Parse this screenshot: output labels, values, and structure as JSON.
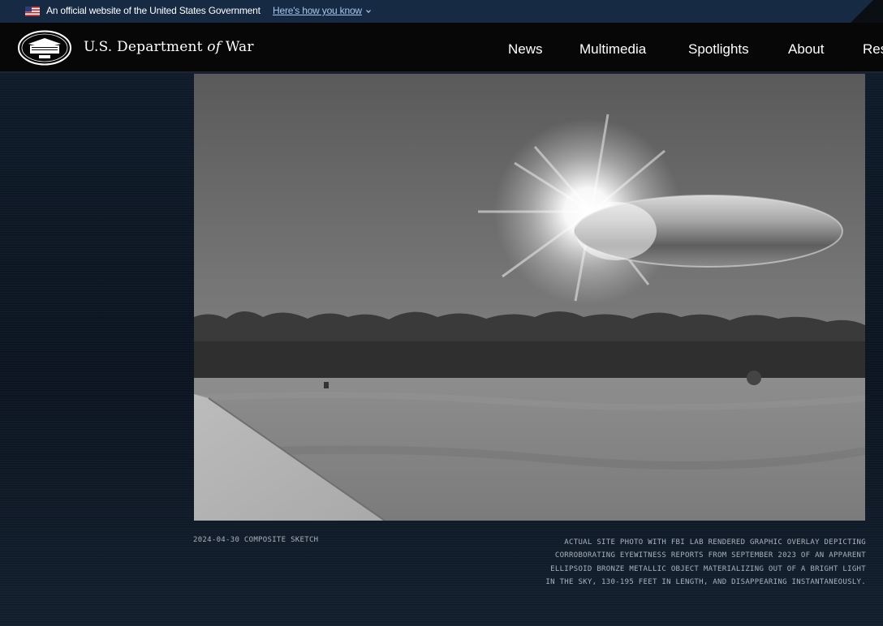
{
  "gov_banner": {
    "text": "An official website of the United States Government",
    "link_label": "Here's how you know"
  },
  "header": {
    "brand_prefix": "U.S. Department",
    "brand_of": "of",
    "brand_suffix": "War",
    "nav": [
      {
        "label": "News"
      },
      {
        "label": "Multimedia"
      },
      {
        "label": "Spotlights"
      },
      {
        "label": "About"
      },
      {
        "label": "Res"
      }
    ]
  },
  "media": {
    "image_label": "Black and white field photo with bright light and ellipsoid object overlay",
    "caption_left": "2024-04-30 COMPOSITE SKETCH",
    "caption_right": "ACTUAL SITE PHOTO WITH FBI LAB RENDERED GRAPHIC OVERLAY DEPICTING CORROBORATING EYEWITNESS REPORTS FROM SEPTEMBER 2023 OF AN APPARENT ELLIPSOID BRONZE METALLIC OBJECT MATERIALIZING OUT OF A BRIGHT LIGHT IN THE SKY, 130-195 FEET IN LENGTH, AND DISAPPEARING INSTANTANEOUSLY."
  },
  "colors": {
    "banner_bg": "#162a43",
    "header_bg": "#070707",
    "page_bg": "#0d1622",
    "link": "#a7c8ee",
    "caption": "#aab2bd"
  },
  "icons": {
    "flag": "us-flag-icon",
    "chevron": "chevron-down-icon",
    "seal": "pentagon-seal-icon"
  }
}
